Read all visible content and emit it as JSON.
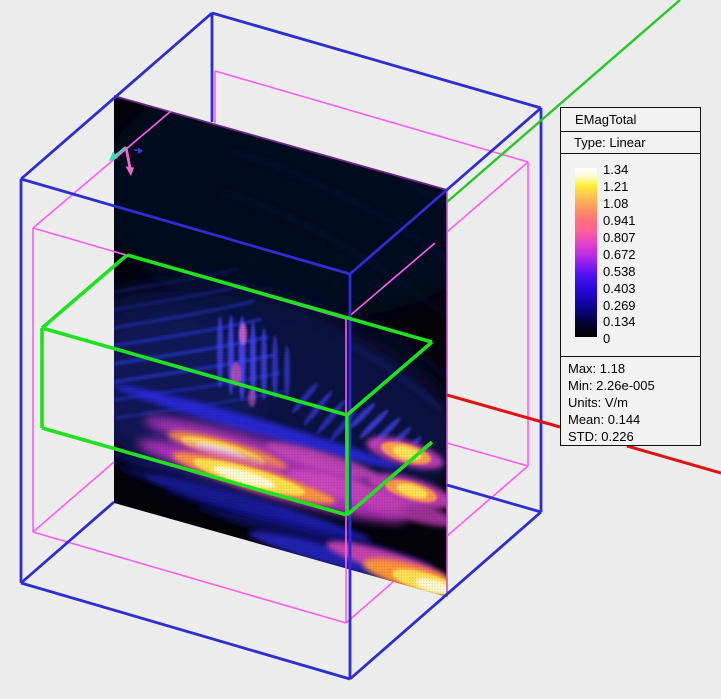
{
  "legend": {
    "title": "EMagTotal",
    "type": "Type: Linear",
    "colorbar_ticks": [
      "1.34",
      "1.21",
      "1.08",
      "0.941",
      "0.807",
      "0.672",
      "0.538",
      "0.403",
      "0.269",
      "0.134",
      "0"
    ],
    "colorbar_gradient": [
      {
        "pos": 0.0,
        "color": "#ffffff"
      },
      {
        "pos": 0.05,
        "color": "#fffbd0"
      },
      {
        "pos": 0.1,
        "color": "#fff23a"
      },
      {
        "pos": 0.17,
        "color": "#ffc050"
      },
      {
        "pos": 0.24,
        "color": "#ff9560"
      },
      {
        "pos": 0.31,
        "color": "#ff7078"
      },
      {
        "pos": 0.37,
        "color": "#ff5f9a"
      },
      {
        "pos": 0.44,
        "color": "#e944c6"
      },
      {
        "pos": 0.5,
        "color": "#c232e2"
      },
      {
        "pos": 0.57,
        "color": "#8c1cf0"
      },
      {
        "pos": 0.64,
        "color": "#4812f0"
      },
      {
        "pos": 0.72,
        "color": "#2409d8"
      },
      {
        "pos": 0.8,
        "color": "#1205a8"
      },
      {
        "pos": 0.88,
        "color": "#070358"
      },
      {
        "pos": 0.95,
        "color": "#02021c"
      },
      {
        "pos": 1.0,
        "color": "#000000"
      }
    ],
    "stats": [
      "Max: 1.18",
      "Min: 2.26e-005",
      "Units: V/m",
      "Mean: 0.144",
      "STD: 0.226"
    ]
  },
  "field": {
    "name": "EMagTotal",
    "scale_type": "Linear",
    "max": "1.18",
    "min": "2.26e-005",
    "units": "V/m",
    "mean": "0.144",
    "std": "0.226"
  },
  "scene": {
    "colors": {
      "background": "#ececec",
      "outer_box": "#2d2dd4",
      "inner_box": "#ff5df2",
      "object_box": "#1fe11f",
      "axis_green": "#27c827",
      "axis_red": "#e11212",
      "slice_edge_top": "#6a2586",
      "slice_edge_right": "#c25acc",
      "triad_cyan": "#3ed9b0",
      "triad_pink": "#ef6ac9",
      "triad_blue": "#3a3ae0"
    }
  }
}
